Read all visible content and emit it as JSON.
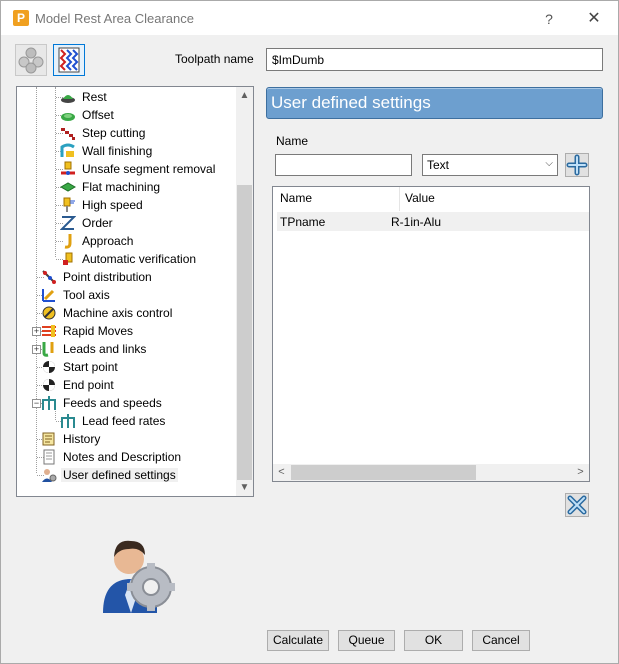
{
  "window": {
    "title": "Model Rest Area Clearance",
    "help_glyph": "?",
    "close_glyph": "✕",
    "app_glyph": "P"
  },
  "toolpath": {
    "label": "Toolpath name",
    "value": "$ImDumb"
  },
  "tree": {
    "items": [
      {
        "label": "Rest",
        "icon": "rest-icon"
      },
      {
        "label": "Offset",
        "icon": "offset-icon"
      },
      {
        "label": "Step cutting",
        "icon": "step-cutting-icon"
      },
      {
        "label": "Wall finishing",
        "icon": "wall-finishing-icon"
      },
      {
        "label": "Unsafe segment removal",
        "icon": "unsafe-segment-icon"
      },
      {
        "label": "Flat machining",
        "icon": "flat-machining-icon"
      },
      {
        "label": "High speed",
        "icon": "high-speed-icon"
      },
      {
        "label": "Order",
        "icon": "order-icon"
      },
      {
        "label": "Approach",
        "icon": "approach-icon"
      },
      {
        "label": "Automatic verification",
        "icon": "verification-icon"
      },
      {
        "label": "Point distribution",
        "icon": "point-distribution-icon"
      },
      {
        "label": "Tool axis",
        "icon": "tool-axis-icon"
      },
      {
        "label": "Machine axis control",
        "icon": "machine-axis-icon"
      },
      {
        "label": "Rapid Moves",
        "icon": "rapid-moves-icon"
      },
      {
        "label": "Leads and links",
        "icon": "leads-links-icon"
      },
      {
        "label": "Start point",
        "icon": "start-point-icon"
      },
      {
        "label": "End point",
        "icon": "end-point-icon"
      },
      {
        "label": "Feeds and speeds",
        "icon": "feeds-speeds-icon"
      },
      {
        "label": "Lead feed rates",
        "icon": "lead-feed-icon"
      },
      {
        "label": "History",
        "icon": "history-icon"
      },
      {
        "label": "Notes and Description",
        "icon": "notes-icon"
      },
      {
        "label": "User defined settings",
        "icon": "user-settings-icon"
      }
    ],
    "selected": "User defined settings",
    "scroll_up": "▲",
    "scroll_down": "▼"
  },
  "panel": {
    "header": "User defined settings",
    "name_label": "Name",
    "name_value": "",
    "type_selected": "Text",
    "table": {
      "columns": [
        "Name",
        "Value"
      ],
      "rows": [
        {
          "name": "TPname",
          "value": "R-1in-Alu"
        }
      ]
    },
    "scroll_left": "<",
    "scroll_right": ">"
  },
  "buttons": {
    "calculate": "Calculate",
    "queue": "Queue",
    "ok": "OK",
    "cancel": "Cancel"
  },
  "colors": {
    "header_blue": "#6d9fcf",
    "selection": "#f0f0f0"
  }
}
